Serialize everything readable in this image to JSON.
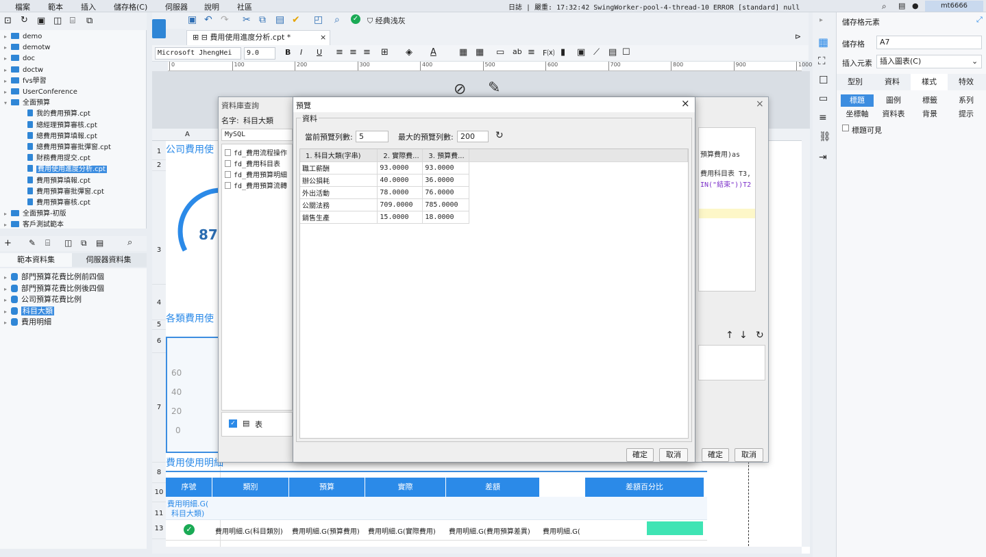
{
  "menubar": {
    "items": [
      "檔案",
      "範本",
      "插入",
      "儲存格(C)",
      "伺服器",
      "說明",
      "社區"
    ],
    "log": "日誌 | 嚴重: 17:32:42 SwingWorker-pool-4-thread-10 ERROR [standard] null",
    "user": "mt6666"
  },
  "tree": {
    "items": [
      {
        "label": "demo",
        "type": "folder",
        "depth": 0
      },
      {
        "label": "demotw",
        "type": "folder",
        "depth": 0
      },
      {
        "label": "doc",
        "type": "folder",
        "depth": 0
      },
      {
        "label": "doctw",
        "type": "folder",
        "depth": 0
      },
      {
        "label": "fvs學習",
        "type": "folder",
        "depth": 0
      },
      {
        "label": "UserConference",
        "type": "folder",
        "depth": 0
      },
      {
        "label": "全面預算",
        "type": "folder",
        "depth": 0,
        "open": true
      },
      {
        "label": "我的費用預算.cpt",
        "type": "file",
        "depth": 1
      },
      {
        "label": "總經理預算審核.cpt",
        "type": "file",
        "depth": 1
      },
      {
        "label": "總費用預算填報.cpt",
        "type": "file",
        "depth": 1
      },
      {
        "label": "總費用預算審批彈窗.cpt",
        "type": "file",
        "depth": 1
      },
      {
        "label": "財務費用提交.cpt",
        "type": "file",
        "depth": 1
      },
      {
        "label": "費用使用進度分析.cpt",
        "type": "file",
        "depth": 1,
        "selected": true
      },
      {
        "label": "費用預算填報.cpt",
        "type": "file",
        "depth": 1
      },
      {
        "label": "費用預算審批彈窗.cpt",
        "type": "file",
        "depth": 1
      },
      {
        "label": "費用預算審核.cpt",
        "type": "file",
        "depth": 1
      },
      {
        "label": "全面預算-初版",
        "type": "folder",
        "depth": 0
      },
      {
        "label": "客戶測試範本",
        "type": "folder",
        "depth": 0
      }
    ]
  },
  "ds_tabs": [
    "範本資料集",
    "伺服器資料集"
  ],
  "datasets": [
    {
      "label": "部門預算花費比例前四個"
    },
    {
      "label": "部門預算花費比例後四個"
    },
    {
      "label": "公司預算花費比例"
    },
    {
      "label": "科目大類",
      "selected": true
    },
    {
      "label": "費用明細"
    }
  ],
  "toolbar": {
    "theme_label": "经典浅灰"
  },
  "filetab": {
    "name": "費用使用進度分析.cpt *"
  },
  "format": {
    "font": "Microsoft JhengHei",
    "size": "9.0"
  },
  "ruler": [
    "0",
    "100",
    "200",
    "300",
    "400",
    "500",
    "600",
    "700",
    "800",
    "900",
    "1000"
  ],
  "sheet": {
    "col_a": "A",
    "row_nums": [
      "1",
      "2",
      "3",
      "4",
      "5",
      "6",
      "7",
      "8",
      "10",
      "11",
      "13"
    ],
    "title1": "公司費用使",
    "gauge_value": "87",
    "title2": "各類費用使",
    "title3": "費用使用明細",
    "yticks": [
      "60",
      "40",
      "20",
      "0"
    ],
    "headers": [
      "序號",
      "類別",
      "預算",
      "實際",
      "差額",
      "",
      "差額百分比"
    ],
    "row11": "費用明細.G(",
    "row11b": "科目大類)",
    "row13": [
      "費用明細.G(科目類別)",
      "費用明細.G(預算費用)",
      "費用明細.G(實際費用)",
      "費用明細.G(費用預算差異)",
      "費用明細.G("
    ]
  },
  "dbquery": {
    "title": "資料庫查詢",
    "name_label": "名字:",
    "name_value": "科目大類",
    "db": "MySQL",
    "tables": [
      "fd_費用流程操作",
      "fd_費用科目表",
      "fd_費用預算明細",
      "fd_費用預算流轉"
    ],
    "sql_lines": [
      "預算費用)as",
      "費用科目表 T3,",
      "IN(\"結束\"))T2"
    ],
    "table_check_label": "表",
    "ok": "確定",
    "cancel": "取消"
  },
  "preview": {
    "title": "預覽",
    "section": "資料",
    "current_rows_label": "當前預覽列數:",
    "current_rows": "5",
    "max_rows_label": "最大的預覽列數:",
    "max_rows": "200",
    "columns": [
      "1. 科目大類(字串)",
      "2. 實際費...",
      "3. 預算費..."
    ],
    "rows": [
      [
        "職工薪酬",
        "93.0000",
        "93.0000"
      ],
      [
        "辦公損耗",
        "40.0000",
        "36.0000"
      ],
      [
        "外出活動",
        "78.0000",
        "76.0000"
      ],
      [
        "公關法務",
        "709.0000",
        "785.0000"
      ],
      [
        "銷售生產",
        "15.0000",
        "18.0000"
      ]
    ],
    "ok": "確定",
    "cancel": "取消"
  },
  "rightpanel": {
    "title": "儲存格元素",
    "cell_label": "儲存格",
    "cell_value": "A7",
    "insert_label": "插入元素",
    "insert_value": "插入圖表(C)",
    "tabs": [
      "型別",
      "資料",
      "樣式",
      "特效"
    ],
    "subtabs": [
      "標題",
      "圖例",
      "標籤",
      "系列",
      "坐標軸",
      "資料表",
      "背景",
      "提示"
    ],
    "title_visible": "標題可見"
  }
}
